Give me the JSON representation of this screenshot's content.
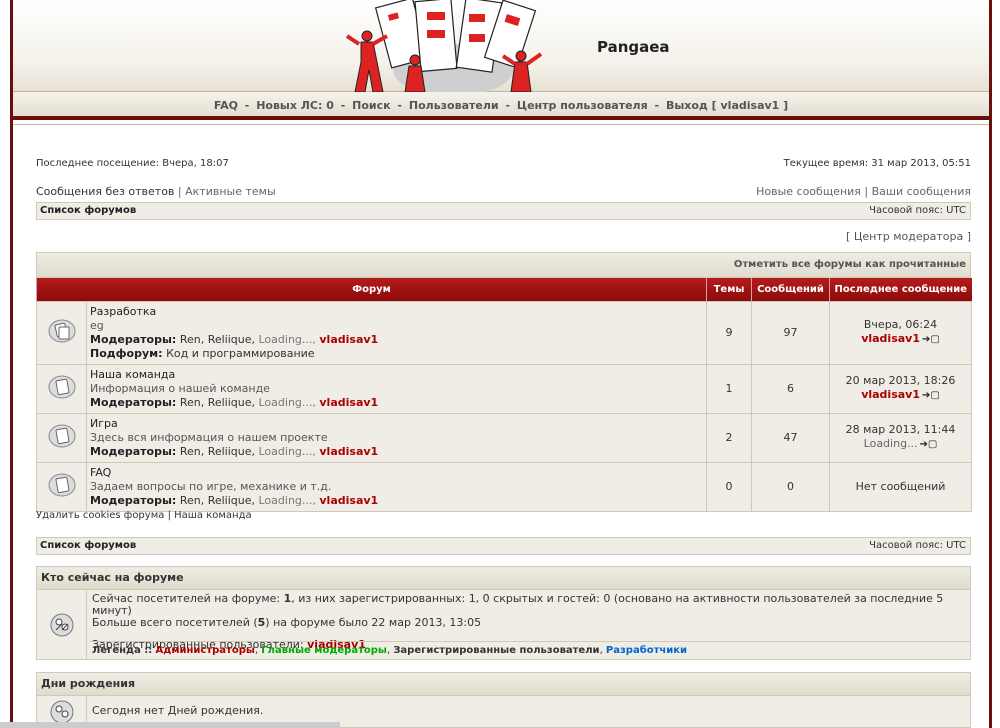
{
  "header": {
    "site_title": "Pangaea"
  },
  "nav": {
    "faq": "FAQ",
    "new_pm": "Новых ЛС: 0",
    "search": "Поиск",
    "users": "Пользователи",
    "ucp": "Центр пользователя",
    "logout": "Выход [ vladisav1 ]"
  },
  "info": {
    "last_visit": "Последнее посещение: Вчера, 18:07",
    "current_time": "Текущее время: 31 мар 2013, 05:51"
  },
  "quicklinks": {
    "unanswered": "Сообщения без ответов",
    "active": "Активные темы",
    "new_posts": "Новые сообщения",
    "your_posts": "Ваши сообщения"
  },
  "bar1": {
    "forum_list": "Список форумов",
    "timezone": "Часовой пояс: UTC"
  },
  "mcp_link": "[ Центр модератора ]",
  "mark_read": "Отметить все форумы как прочитанные",
  "columns": {
    "forum": "Форум",
    "topics": "Темы",
    "posts": "Сообщений",
    "last_post": "Последнее сообщение"
  },
  "forums": [
    {
      "title": "Разработка",
      "desc": "eg",
      "mods_label": "Модераторы:",
      "mods": "Ren, Reliique,",
      "mods_loading": "Loading...,",
      "mods_user": "vladisav1",
      "sub_label": "Подфорум:",
      "sub": "Код и программирование",
      "topics": "9",
      "posts": "97",
      "last_date": "Вчера, 06:24",
      "last_user": "vladisav1",
      "last_user_red": true
    },
    {
      "title": "Наша команда",
      "desc": "Информация о нашей команде",
      "mods_label": "Модераторы:",
      "mods": "Ren, Reliique,",
      "mods_loading": "Loading...,",
      "mods_user": "vladisav1",
      "topics": "1",
      "posts": "6",
      "last_date": "20 мар 2013, 18:26",
      "last_user": "vladisav1",
      "last_user_red": true
    },
    {
      "title": "Игра",
      "desc": "Здесь вся информация о нашем проекте",
      "mods_label": "Модераторы:",
      "mods": "Ren, Reliique,",
      "mods_loading": "Loading...,",
      "mods_user": "vladisav1",
      "topics": "2",
      "posts": "47",
      "last_date": "28 мар 2013, 11:44",
      "last_user": "Loading...",
      "last_user_red": false
    },
    {
      "title": "FAQ",
      "desc": "Задаем вопросы по игре, механике и т.д.",
      "mods_label": "Модераторы:",
      "mods": "Ren, Reliique,",
      "mods_loading": "Loading...,",
      "mods_user": "vladisav1",
      "topics": "0",
      "posts": "0",
      "last_none": "Нет сообщений"
    }
  ],
  "footer_links": {
    "delete_cookies": "Удалить cookies форума",
    "team": "Наша команда"
  },
  "bar2": {
    "forum_list": "Список форумов",
    "timezone": "Часовой пояс: UTC"
  },
  "online": {
    "title": "Кто сейчас на форуме",
    "line1_a": "Сейчас посетителей на форуме: ",
    "line1_n": "1",
    "line1_b": ", из них зарегистрированных: 1, 0 скрытых и гостей: 0 (основано на активности пользователей за последние 5 минут)",
    "line2_a": "Больше всего посетителей (",
    "line2_n": "5",
    "line2_b": ") на форуме было 22 мар 2013, 13:05",
    "registered_label": "Зарегистрированные пользователи: ",
    "registered_user": "vladisav1",
    "legend_label": "Легенда ::",
    "legend_admins": "Администраторы",
    "legend_gmods": "Главные модераторы",
    "legend_reg": "Зарегистрированные пользователи",
    "legend_devs": "Разработчики"
  },
  "birthdays": {
    "title": "Дни рождения",
    "text": "Сегодня нет Дней рождения."
  },
  "colors": {
    "brand_red": "#8c0a0a",
    "frame": "#6a0e0e",
    "row_bg": "#efede6"
  }
}
